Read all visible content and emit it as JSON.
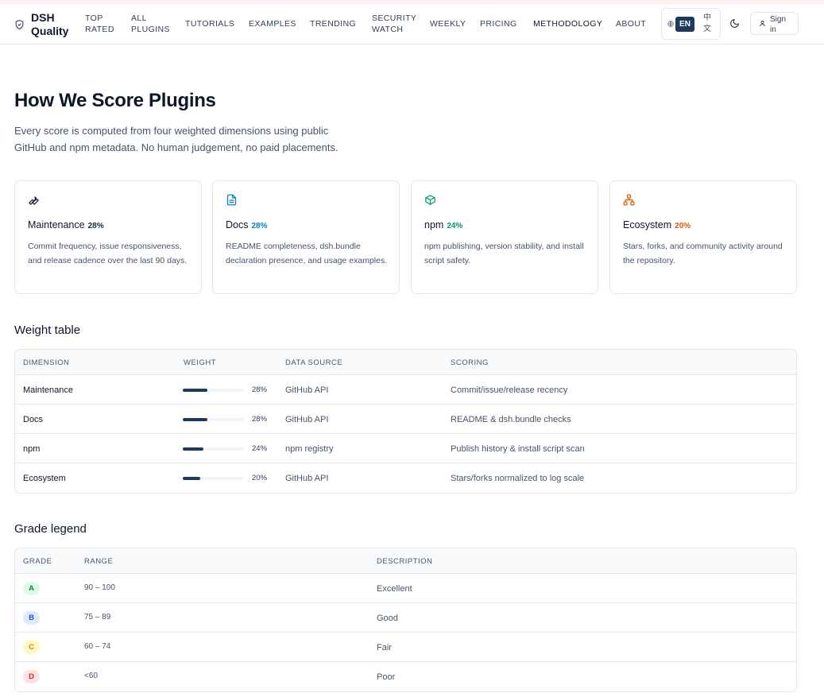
{
  "brand": {
    "name": "DSH Quality"
  },
  "nav": [
    {
      "label": "Top\nRated"
    },
    {
      "label": "All\nPlugins"
    },
    {
      "label": "Tutorials"
    },
    {
      "label": "Examples"
    },
    {
      "label": "Trending"
    },
    {
      "label": "Security\nWatch"
    },
    {
      "label": "Weekly"
    },
    {
      "label": "Pricing"
    },
    {
      "label": "Methodology"
    },
    {
      "label": "About"
    }
  ],
  "lang": {
    "current": "EN",
    "alt": "中文"
  },
  "auth": {
    "signin_label": "Sign in"
  },
  "hero": {
    "title": "How We Score Plugins",
    "subtitle": "Every score is computed from four weighted dimensions using public GitHub and npm metadata. No human judgement, no paid placements."
  },
  "cards": [
    {
      "icon": "wrench-icon",
      "title": "Maintenance",
      "pct": "28%",
      "color": "#1e293b",
      "desc": "Commit frequency, issue responsiveness, and release cadence over the last 90 days."
    },
    {
      "icon": "document-icon",
      "title": "Docs",
      "pct": "28%",
      "color": "#0284c7",
      "desc": "README completeness, dsh.bundle declaration presence, and usage examples."
    },
    {
      "icon": "package-icon",
      "title": "npm",
      "pct": "24%",
      "color": "#059669",
      "desc": "npm publishing, version stability, and install script safety."
    },
    {
      "icon": "network-icon",
      "title": "Ecosystem",
      "pct": "20%",
      "color": "#ea580c",
      "desc": "Stars, forks, and community activity around the repository."
    }
  ],
  "weight_table": {
    "title": "Weight table",
    "headers": [
      "Dimension",
      "Weight",
      "Data source",
      "Scoring"
    ],
    "rows": [
      {
        "dimension": "Maintenance",
        "weight": 0.28,
        "weight_label": "28%",
        "source": "GitHub API",
        "scoring": "Commit/issue/release recency"
      },
      {
        "dimension": "Docs",
        "weight": 0.28,
        "weight_label": "28%",
        "source": "GitHub API",
        "scoring": "README & dsh.bundle checks"
      },
      {
        "dimension": "npm",
        "weight": 0.24,
        "weight_label": "24%",
        "source": "npm registry",
        "scoring": "Publish history & install script scan"
      },
      {
        "dimension": "Ecosystem",
        "weight": 0.2,
        "weight_label": "20%",
        "source": "GitHub API",
        "scoring": "Stars/forks normalized to log scale"
      }
    ]
  },
  "grade_legend": {
    "title": "Grade legend",
    "headers": [
      "Grade",
      "Range",
      "Description"
    ],
    "rows": [
      {
        "grade": "A",
        "range": "90 – 100",
        "description": "Excellent",
        "color": "#15803d",
        "bg": "#dcfce7"
      },
      {
        "grade": "B",
        "range": "75 – 89",
        "description": "Good",
        "color": "#1d4ed8",
        "bg": "#dbeafe"
      },
      {
        "grade": "C",
        "range": "60 – 74",
        "description": "Fair",
        "color": "#ca8a04",
        "bg": "#fef9c3"
      },
      {
        "grade": "D",
        "range": "<60",
        "description": "Poor",
        "color": "#dc2626",
        "bg": "#fee2e2"
      }
    ]
  }
}
